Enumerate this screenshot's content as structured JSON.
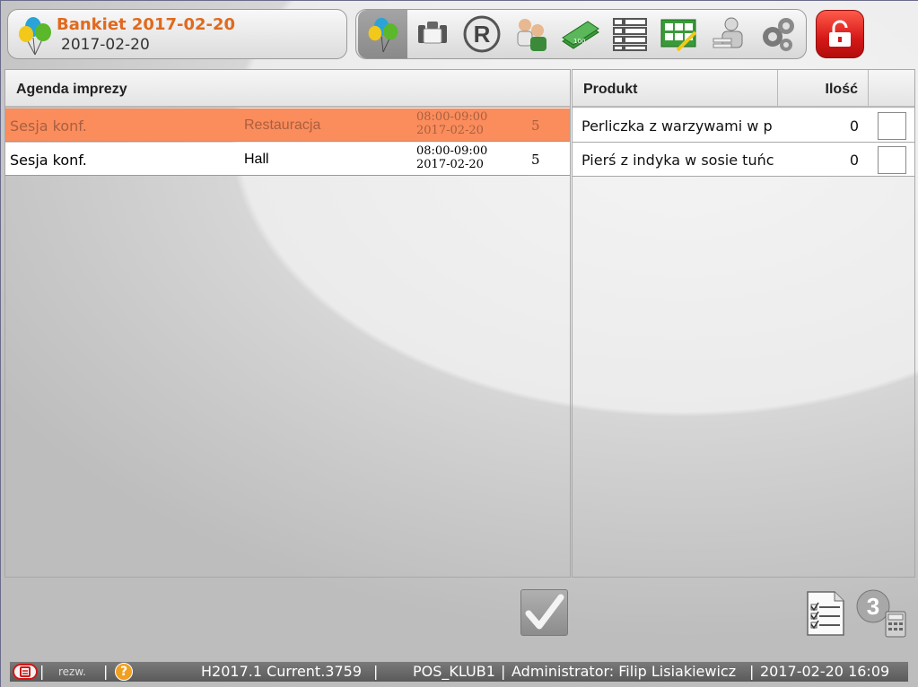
{
  "header": {
    "event_title": "Bankiet 2017-02-20",
    "event_date": "2017-02-20"
  },
  "toolbar": {
    "icons": [
      "balloons-icon",
      "banquet-table-icon",
      "reservation-r-icon",
      "guests-icon",
      "money-icon",
      "list-grid-icon",
      "checklist-board-icon",
      "staff-icon",
      "settings-gears-icon"
    ],
    "active_index": 0
  },
  "lock_button": {
    "icon": "unlocked-padlock-icon",
    "color": "#d51818"
  },
  "agenda": {
    "header": "Agenda imprezy",
    "rows": [
      {
        "name": "Sesja konf.",
        "place": "Restauracja",
        "time": "08:00-09:00",
        "date": "2017-02-20",
        "count": "5",
        "selected": true
      },
      {
        "name": "Sesja konf.",
        "place": "Hall",
        "time": "08:00-09:00",
        "date": "2017-02-20",
        "count": "5",
        "selected": false
      }
    ]
  },
  "products": {
    "header_product": "Produkt",
    "header_qty": "Ilość",
    "rows": [
      {
        "name": "Perliczka z warzywami w p",
        "qty": "0"
      },
      {
        "name": "Pierś z indyka w sosie tuńc",
        "qty": "0"
      }
    ]
  },
  "status_bar": {
    "rezw": "rezw.",
    "help": "?",
    "version": "H2017.1 Current.3759",
    "pos": "POS_KLUB1",
    "user": "Administrator: Filip Lisiakiewicz",
    "datetime": "2017-02-20 16:09"
  },
  "colors": {
    "accent_orange": "#e06a1e",
    "selected_row": "#fb8c5c"
  }
}
